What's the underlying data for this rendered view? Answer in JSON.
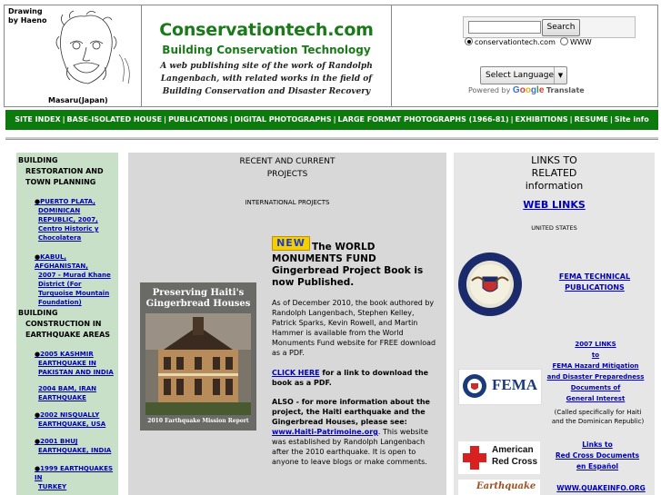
{
  "header": {
    "drawing_label": "Drawing\nby Haeno",
    "portrait_caption": "Masaru(Japan)",
    "site_title": "Conservationtech.com",
    "site_subtitle": "Building Conservation Technology",
    "site_description": "A web publishing site of the work of Randolph Langenbach, with related works in the field of Building Conservation and Disaster Recovery",
    "search": {
      "input_value": "",
      "button_label": "Search",
      "option_site": "conservationtech.com",
      "option_web": "WWW",
      "selected": "conservationtech.com"
    },
    "language": {
      "select_label": "Select Language",
      "powered_by": "Powered by",
      "google": "Google",
      "translate": "Translate"
    }
  },
  "nav": {
    "items": [
      "SITE INDEX",
      "BASE-ISOLATED HOUSE",
      "PUBLICATIONS",
      "DIGITAL PHOTOGRAPHS",
      "LARGE FORMAT PHOTOGRAPHS (1966-81)",
      "EXHIBITIONS",
      "RESUME",
      "Site info"
    ]
  },
  "left": {
    "heading1_a": "BUILDING",
    "heading1_b": "RESTORATION AND",
    "heading1_c": "TOWN PLANNING",
    "links1": [
      [
        "PUERTO PLATA,",
        "DOMINICAN",
        "REPUBLIC, 2007,",
        "Centro Historic y",
        "Chocolatera"
      ],
      [
        "KABUL, AFGHANISTAN,",
        "2007 - Murad Khane",
        "District (For",
        "Turquoise Mountain",
        "Foundation)"
      ]
    ],
    "heading2_a": "BUILDING",
    "heading2_b": "CONSTRUCTION IN",
    "heading2_c": "EARTHQUAKE AREAS",
    "links2": [
      [
        "2005 KASHMIR",
        "EARTHQUAKE IN",
        "PAKISTAN AND INDIA"
      ],
      [
        "2004 BAM, IRAN",
        "EARTHQUAKE"
      ],
      [
        "2002 NISQUALLY",
        "EARTHQUAKE, USA"
      ],
      [
        "2001 BHUJ",
        "EARTHQUAKE, INDIA"
      ],
      [
        "1999 EARTHQUAKES IN",
        "TURKEY"
      ]
    ]
  },
  "middle": {
    "title_a": "RECENT AND CURRENT",
    "title_b": "PROJECTS",
    "intl": "INTERNATIONAL PROJECTS",
    "book": {
      "title_a": "Preserving Haiti's",
      "title_b": "Gingerbread Houses",
      "footer": "2010 Earthquake Mission Report"
    },
    "new_badge": "NEW",
    "heading": "The WORLD MONUMENTS FUND Gingerbread Project Book is now Published.",
    "body": "As of December 2010, the book authored by Randolph Langenbach, Stephen Kelley, Patrick Sparks, Kevin Rowell, and Martin Hammer is available from the World Monuments Fund website for FREE download as a PDF.",
    "click_here": "CLICK HERE",
    "click_here_rest": " for a link to download the book as a PDF.",
    "also_a": "ALSO - for more information about the project, the Haiti earthquake and the Gingerbread Houses, please see: ",
    "also_link": "www.Haiti-Patrimoine.org",
    "also_b": ".  This website was established by Randolph Langenbach after the 2010 earthquake. It is open to anyone to leave blogs or make comments."
  },
  "right": {
    "title_a": "LINKS TO",
    "title_b": "RELATED",
    "title_c": "information",
    "web_links": "WEB LINKS",
    "united_states": "UNITED STATES",
    "fema_tech_a": "FEMA TECHNICAL",
    "fema_tech_b": "PUBLICATIONS",
    "fema_2007": [
      "2007 LINKS",
      "to",
      "FEMA Hazard Mitigation",
      "and Disaster Preparedness",
      "Documents of",
      "General Interest"
    ],
    "fema_note_a": "(Called specifically for Haiti",
    "fema_note_b": "and the Dominican Republic)",
    "fema_logo_text": "FEMA",
    "redcross_a": "Links to",
    "redcross_b": "Red Cross Documents",
    "redcross_c": "en Español",
    "redcross_logo_a": "American",
    "redcross_logo_b": "Red Cross",
    "quakeinfo": "WWW.QUAKEINFO.ORG",
    "eq_logo_text": "Earthquake"
  }
}
